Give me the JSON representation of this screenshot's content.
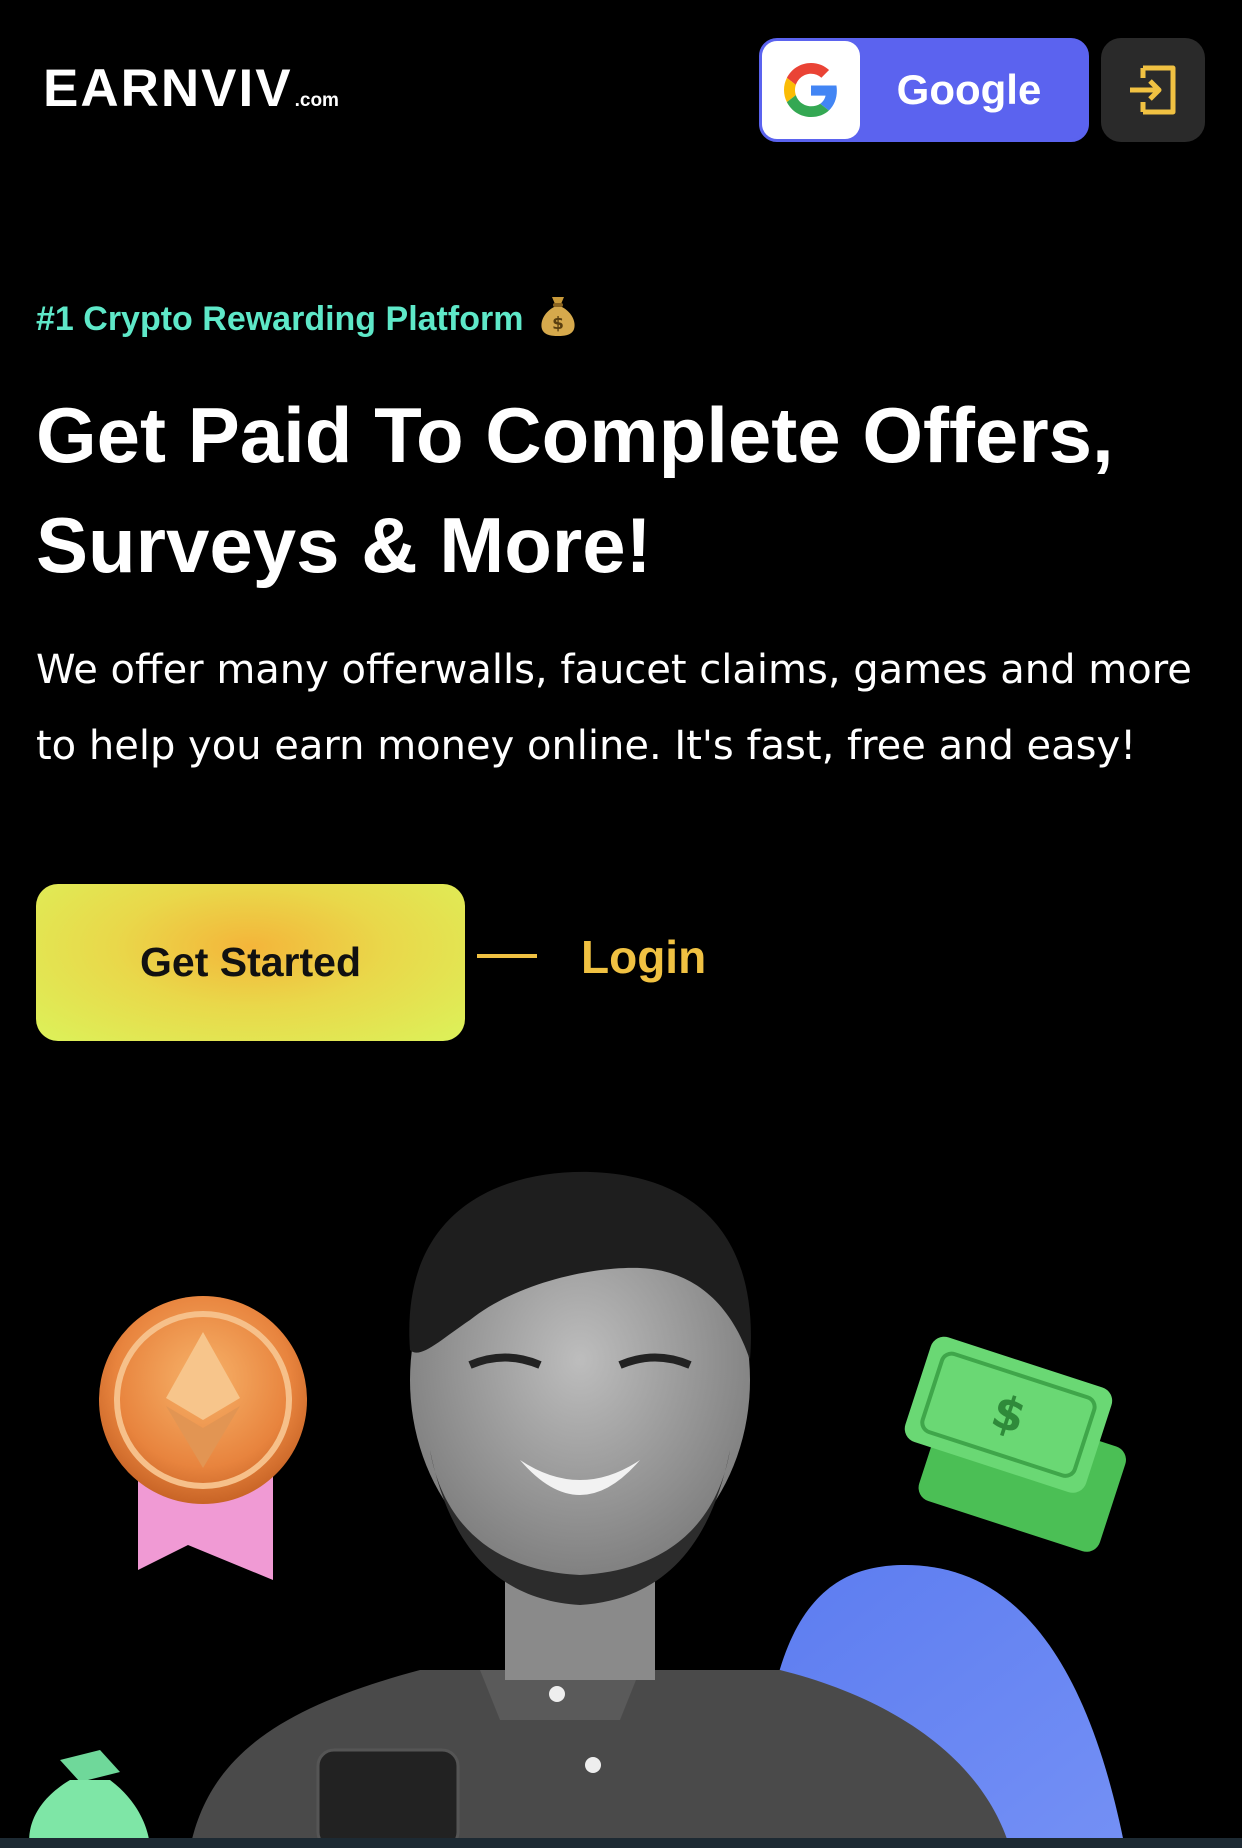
{
  "header": {
    "logo_main": "EARNVIV",
    "logo_suffix": ".com",
    "google_button_label": "Google",
    "login_icon": "login-icon"
  },
  "hero": {
    "tagline": "#1 Crypto Rewarding Platform",
    "tagline_icon": "money-bag-icon",
    "headline_line1": "Get Paid To Complete Offers,",
    "headline_line2": "Surveys & More!",
    "description": "We offer many offerwalls, faucet claims, games and more to help you earn money online. It's fast, free and easy!",
    "get_started_label": "Get Started",
    "login_label": "Login"
  },
  "illustration": {
    "items": [
      "ethereum-medal-icon",
      "man-smiling-photo",
      "dollar-bills-icon",
      "money-bag-icon"
    ]
  },
  "colors": {
    "background": "#000000",
    "accent_teal": "#5ee8c8",
    "accent_gold": "#f0c142",
    "google_blue": "#5b63ef",
    "blob_blue": "#6f86f2"
  }
}
